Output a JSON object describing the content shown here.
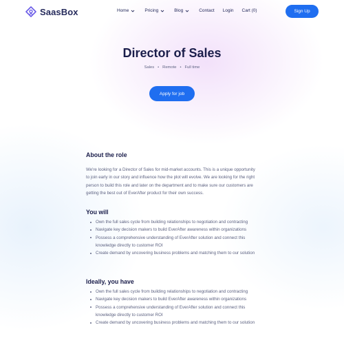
{
  "brand": {
    "name": "SaasBox",
    "accent": "#1f6ef0"
  },
  "nav": {
    "items": [
      {
        "label": "Home",
        "dropdown": true
      },
      {
        "label": "Pricing",
        "dropdown": true
      },
      {
        "label": "Blog",
        "dropdown": true
      },
      {
        "label": "Contact",
        "dropdown": false
      },
      {
        "label": "Login",
        "dropdown": false
      },
      {
        "label": "Cart (0)",
        "dropdown": false
      }
    ],
    "signup_label": "Sign Up"
  },
  "job": {
    "title": "Director of Sales",
    "meta": [
      "Sales",
      "Remote",
      "Full time"
    ],
    "apply_label": "Apply for job"
  },
  "about": {
    "heading": "About the role",
    "body": "We're looking for a Director of Sales for mid-market accounts. This is a unique opportunity to join early in our story and influence how the plot will evolve. We are looking for the right person to build this role and later on the department and to make sure our customers are getting the best out of EverAfter product for their own success."
  },
  "you_will": {
    "heading": "You will",
    "items": [
      "Own the full sales cycle from building relationships to negotiation and contracting",
      "Navigate key decision makers to build EverAfter awareness within organizations",
      "Possess a comprehensive understanding of EverAfter solution and connect this knowledge directly to customer ROI",
      "Create demand by uncovering business problems and matching them to our solution"
    ]
  },
  "you_have": {
    "heading": "Ideally, you have",
    "items": [
      "Own the full sales cycle from building relationships to negotiation and contracting",
      "Navigate key decision makers to build EverAfter awareness within organizations",
      "Possess a comprehensive understanding of EverAfter solution and connect this knowledge directly to customer ROI",
      "Create demand by uncovering business problems and matching them to our solution"
    ]
  }
}
